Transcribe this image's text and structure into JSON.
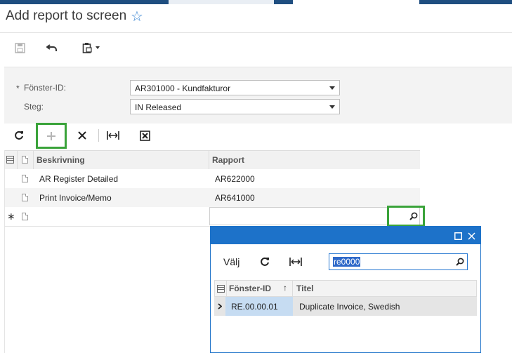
{
  "page": {
    "title": "Add report to screen"
  },
  "toolbar": {
    "save_icon": "save-icon",
    "undo_icon": "undo-icon",
    "clipboard_icon": "clipboard-icon"
  },
  "form": {
    "screen_id_label": "Fönster-ID:",
    "screen_id_value": "AR301000 - Kundfakturor",
    "required_mark": "*",
    "step_label": "Steg:",
    "step_value": "IN Released"
  },
  "grid": {
    "columns": [
      "Beskrivning",
      "Rapport"
    ],
    "rows": [
      {
        "description": "AR Register Detailed",
        "report": "AR622000"
      },
      {
        "description": "Print Invoice/Memo",
        "report": "AR641000"
      }
    ],
    "new_row_mark": "∗"
  },
  "popup": {
    "select_label": "Välj",
    "search_value": "re0000",
    "columns": [
      "Fönster-ID",
      "Titel"
    ],
    "sort_indicator": "↑",
    "rows": [
      {
        "id": "RE.00.00.01",
        "title": "Duplicate Invoice, Swedish"
      }
    ]
  }
}
